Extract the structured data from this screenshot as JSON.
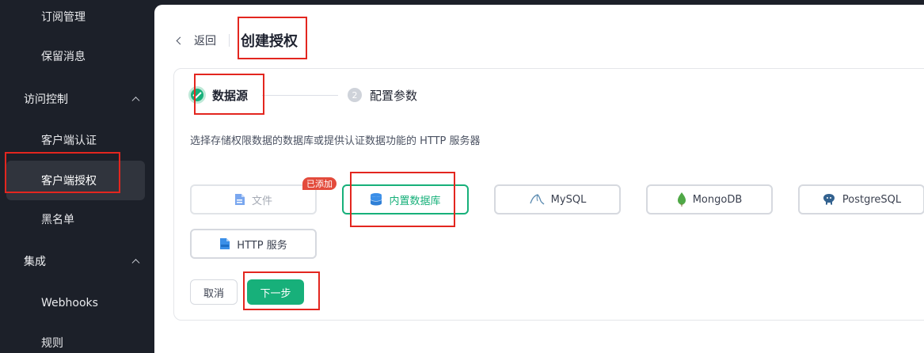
{
  "sidebar": {
    "items": [
      {
        "label": "订阅管理",
        "type": "sub"
      },
      {
        "label": "保留消息",
        "type": "sub"
      },
      {
        "label": "访问控制",
        "type": "group"
      },
      {
        "label": "客户端认证",
        "type": "sub"
      },
      {
        "label": "客户端授权",
        "type": "sub",
        "active": true
      },
      {
        "label": "黑名单",
        "type": "sub"
      },
      {
        "label": "集成",
        "type": "group"
      },
      {
        "label": "Webhooks",
        "type": "sub"
      },
      {
        "label": "规则",
        "type": "sub"
      }
    ]
  },
  "header": {
    "back_label": "返回",
    "title": "创建授权"
  },
  "steps": [
    {
      "label": "数据源",
      "status": "done"
    },
    {
      "number": "2",
      "label": "配置参数",
      "status": "pending"
    }
  ],
  "description": "选择存储权限数据的数据库或提供认证数据功能的 HTTP 服务器",
  "sources": [
    {
      "label": "文件",
      "icon": "file-icon",
      "state": "disabled"
    },
    {
      "label": "内置数据库",
      "icon": "database-icon",
      "state": "selected"
    },
    {
      "label": "MySQL",
      "icon": "mysql-icon",
      "state": "normal"
    },
    {
      "label": "MongoDB",
      "icon": "mongodb-icon",
      "state": "normal"
    },
    {
      "label": "PostgreSQL",
      "icon": "postgresql-icon",
      "state": "normal"
    },
    {
      "label": "HTTP 服务",
      "icon": "http-icon",
      "state": "normal"
    }
  ],
  "badge": "已添加",
  "buttons": {
    "cancel": "取消",
    "next": "下一步"
  },
  "colors": {
    "accent": "#17b07a",
    "sidebar_bg": "#1c2029",
    "highlight": "#e3261f",
    "badge": "#e34b3c"
  }
}
